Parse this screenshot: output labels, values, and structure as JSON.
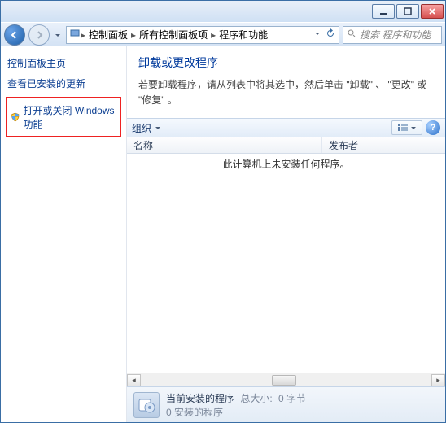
{
  "breadcrumb": {
    "a": "控制面板",
    "b": "所有控制面板项",
    "c": "程序和功能"
  },
  "search": {
    "placeholder": "搜索 程序和功能"
  },
  "sidebar": {
    "home": "控制面板主页",
    "updates": "查看已安装的更新",
    "winfeat": "打开或关闭 Windows 功能"
  },
  "page": {
    "title": "卸载或更改程序",
    "desc": "若要卸载程序，请从列表中将其选中，然后单击 \"卸载\" 、 \"更改\" 或 \"修复\" 。"
  },
  "toolbar": {
    "organize": "组织",
    "help": "?"
  },
  "columns": {
    "name": "名称",
    "publisher": "发布者"
  },
  "list": {
    "empty": "此计算机上未安装任何程序。"
  },
  "status": {
    "title": "当前安装的程序",
    "size_label": "总大小:",
    "size_value": "0 字节",
    "installed": "0 安装的程序"
  }
}
